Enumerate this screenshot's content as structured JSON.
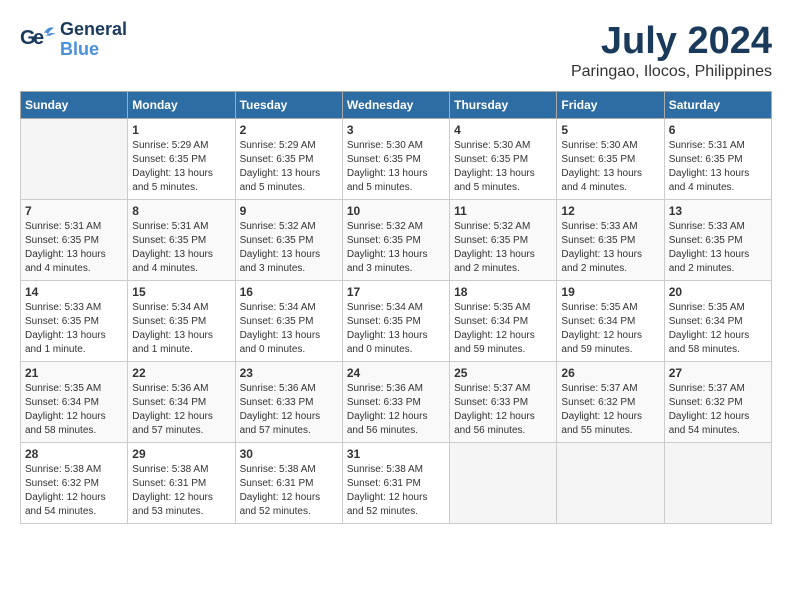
{
  "header": {
    "logo_line1": "General",
    "logo_line2": "Blue",
    "month": "July 2024",
    "location": "Paringao, Ilocos, Philippines"
  },
  "days_of_week": [
    "Sunday",
    "Monday",
    "Tuesday",
    "Wednesday",
    "Thursday",
    "Friday",
    "Saturday"
  ],
  "weeks": [
    [
      null,
      {
        "day": 1,
        "sunrise": "5:29 AM",
        "sunset": "6:35 PM",
        "daylight": "13 hours and 5 minutes."
      },
      {
        "day": 2,
        "sunrise": "5:29 AM",
        "sunset": "6:35 PM",
        "daylight": "13 hours and 5 minutes."
      },
      {
        "day": 3,
        "sunrise": "5:30 AM",
        "sunset": "6:35 PM",
        "daylight": "13 hours and 5 minutes."
      },
      {
        "day": 4,
        "sunrise": "5:30 AM",
        "sunset": "6:35 PM",
        "daylight": "13 hours and 5 minutes."
      },
      {
        "day": 5,
        "sunrise": "5:30 AM",
        "sunset": "6:35 PM",
        "daylight": "13 hours and 4 minutes."
      },
      {
        "day": 6,
        "sunrise": "5:31 AM",
        "sunset": "6:35 PM",
        "daylight": "13 hours and 4 minutes."
      }
    ],
    [
      {
        "day": 7,
        "sunrise": "5:31 AM",
        "sunset": "6:35 PM",
        "daylight": "13 hours and 4 minutes."
      },
      {
        "day": 8,
        "sunrise": "5:31 AM",
        "sunset": "6:35 PM",
        "daylight": "13 hours and 4 minutes."
      },
      {
        "day": 9,
        "sunrise": "5:32 AM",
        "sunset": "6:35 PM",
        "daylight": "13 hours and 3 minutes."
      },
      {
        "day": 10,
        "sunrise": "5:32 AM",
        "sunset": "6:35 PM",
        "daylight": "13 hours and 3 minutes."
      },
      {
        "day": 11,
        "sunrise": "5:32 AM",
        "sunset": "6:35 PM",
        "daylight": "13 hours and 2 minutes."
      },
      {
        "day": 12,
        "sunrise": "5:33 AM",
        "sunset": "6:35 PM",
        "daylight": "13 hours and 2 minutes."
      },
      {
        "day": 13,
        "sunrise": "5:33 AM",
        "sunset": "6:35 PM",
        "daylight": "13 hours and 2 minutes."
      }
    ],
    [
      {
        "day": 14,
        "sunrise": "5:33 AM",
        "sunset": "6:35 PM",
        "daylight": "13 hours and 1 minute."
      },
      {
        "day": 15,
        "sunrise": "5:34 AM",
        "sunset": "6:35 PM",
        "daylight": "13 hours and 1 minute."
      },
      {
        "day": 16,
        "sunrise": "5:34 AM",
        "sunset": "6:35 PM",
        "daylight": "13 hours and 0 minutes."
      },
      {
        "day": 17,
        "sunrise": "5:34 AM",
        "sunset": "6:35 PM",
        "daylight": "13 hours and 0 minutes."
      },
      {
        "day": 18,
        "sunrise": "5:35 AM",
        "sunset": "6:34 PM",
        "daylight": "12 hours and 59 minutes."
      },
      {
        "day": 19,
        "sunrise": "5:35 AM",
        "sunset": "6:34 PM",
        "daylight": "12 hours and 59 minutes."
      },
      {
        "day": 20,
        "sunrise": "5:35 AM",
        "sunset": "6:34 PM",
        "daylight": "12 hours and 58 minutes."
      }
    ],
    [
      {
        "day": 21,
        "sunrise": "5:35 AM",
        "sunset": "6:34 PM",
        "daylight": "12 hours and 58 minutes."
      },
      {
        "day": 22,
        "sunrise": "5:36 AM",
        "sunset": "6:34 PM",
        "daylight": "12 hours and 57 minutes."
      },
      {
        "day": 23,
        "sunrise": "5:36 AM",
        "sunset": "6:33 PM",
        "daylight": "12 hours and 57 minutes."
      },
      {
        "day": 24,
        "sunrise": "5:36 AM",
        "sunset": "6:33 PM",
        "daylight": "12 hours and 56 minutes."
      },
      {
        "day": 25,
        "sunrise": "5:37 AM",
        "sunset": "6:33 PM",
        "daylight": "12 hours and 56 minutes."
      },
      {
        "day": 26,
        "sunrise": "5:37 AM",
        "sunset": "6:32 PM",
        "daylight": "12 hours and 55 minutes."
      },
      {
        "day": 27,
        "sunrise": "5:37 AM",
        "sunset": "6:32 PM",
        "daylight": "12 hours and 54 minutes."
      }
    ],
    [
      {
        "day": 28,
        "sunrise": "5:38 AM",
        "sunset": "6:32 PM",
        "daylight": "12 hours and 54 minutes."
      },
      {
        "day": 29,
        "sunrise": "5:38 AM",
        "sunset": "6:31 PM",
        "daylight": "12 hours and 53 minutes."
      },
      {
        "day": 30,
        "sunrise": "5:38 AM",
        "sunset": "6:31 PM",
        "daylight": "12 hours and 52 minutes."
      },
      {
        "day": 31,
        "sunrise": "5:38 AM",
        "sunset": "6:31 PM",
        "daylight": "12 hours and 52 minutes."
      },
      null,
      null,
      null
    ]
  ]
}
